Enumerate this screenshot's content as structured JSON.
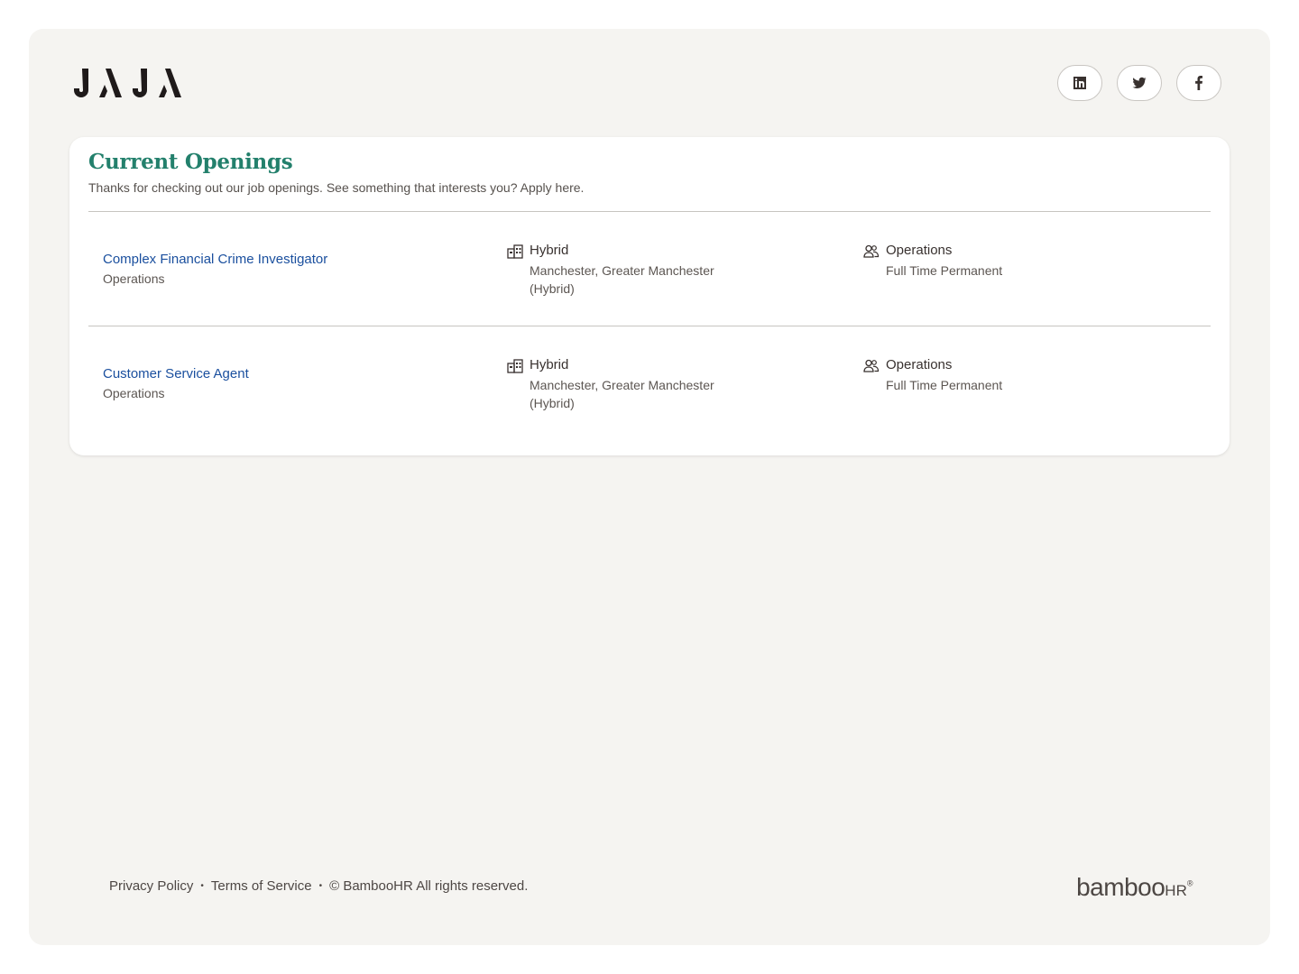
{
  "header": {
    "logo_text": "JAJA",
    "socials": [
      {
        "name": "linkedin-icon"
      },
      {
        "name": "twitter-icon"
      },
      {
        "name": "facebook-icon"
      }
    ]
  },
  "openings": {
    "title": "Current Openings",
    "subtitle": "Thanks for checking out our job openings. See something that interests you? Apply here.",
    "jobs": [
      {
        "title": "Complex Financial Crime Investigator",
        "department": "Operations",
        "location_type": "Hybrid",
        "location": "Manchester, Greater Manchester (Hybrid)",
        "team": "Operations",
        "employment_type": "Full Time Permanent"
      },
      {
        "title": "Customer Service Agent",
        "department": "Operations",
        "location_type": "Hybrid",
        "location": "Manchester, Greater Manchester (Hybrid)",
        "team": "Operations",
        "employment_type": "Full Time Permanent"
      }
    ]
  },
  "footer": {
    "privacy": "Privacy Policy",
    "terms": "Terms of Service",
    "copyright": "© BambooHR All rights reserved.",
    "separator": "•",
    "brand_main": "bamboo",
    "brand_hr": "HR",
    "brand_tm": "®"
  },
  "colors": {
    "accent": "#23806c",
    "link": "#1a4f9e",
    "background": "#f5f4f1"
  }
}
